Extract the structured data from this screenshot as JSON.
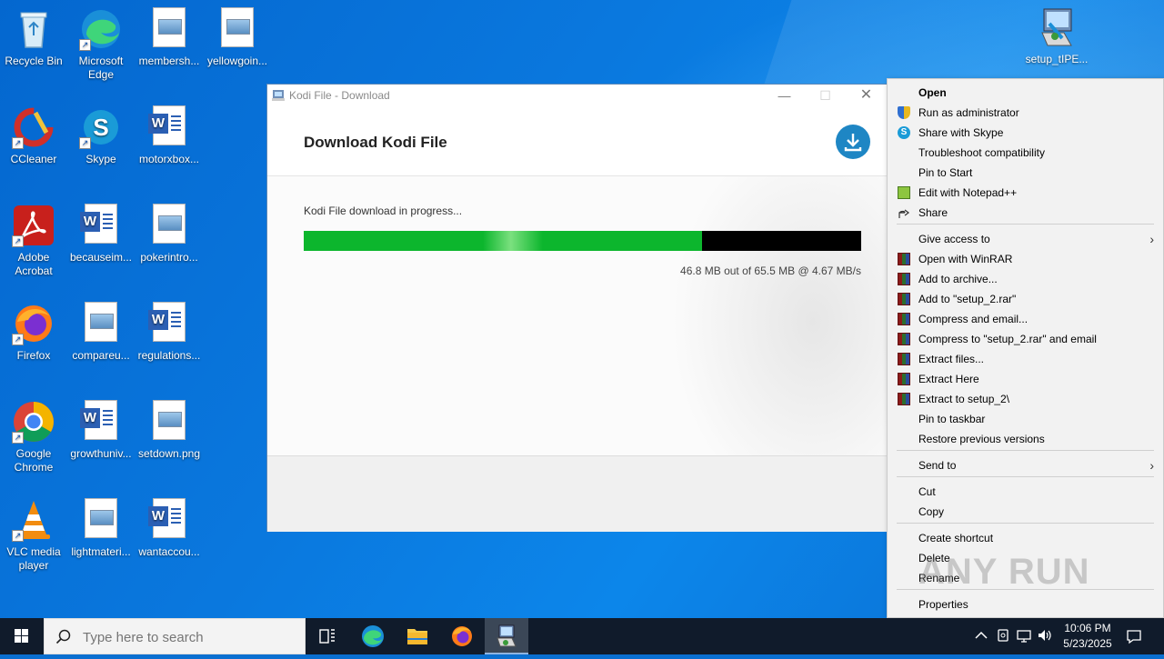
{
  "desktop": {
    "icons": [
      {
        "label": "Recycle Bin"
      },
      {
        "label": "Microsoft Edge"
      },
      {
        "label": "membersh..."
      },
      {
        "label": "yellowgoin..."
      },
      {
        "label": "CCleaner"
      },
      {
        "label": "Skype"
      },
      {
        "label": "motorxbox..."
      },
      {
        "label": "Adobe Acrobat"
      },
      {
        "label": "becauseim..."
      },
      {
        "label": "pokerintro..."
      },
      {
        "label": "Firefox"
      },
      {
        "label": "compareu..."
      },
      {
        "label": "regulations..."
      },
      {
        "label": "Google Chrome"
      },
      {
        "label": "growthuniv..."
      },
      {
        "label": "setdown.png"
      },
      {
        "label": "VLC media player"
      },
      {
        "label": "lightmateri..."
      },
      {
        "label": "wantaccou..."
      },
      {
        "label": "setup_tIPE..."
      }
    ]
  },
  "window": {
    "title": "Kodi File - Download",
    "header": "Download Kodi File",
    "progress_label": "Kodi File download in progress...",
    "progress_fraction": 0.714,
    "size_text": "46.8 MB out of 65.5 MB @ 4.67 MB/s"
  },
  "context_menu": {
    "items": [
      {
        "label": "Open",
        "bold": true
      },
      {
        "label": "Run as administrator",
        "icon": "shield-icon"
      },
      {
        "label": "Share with Skype",
        "icon": "skype-icon"
      },
      {
        "label": "Troubleshoot compatibility"
      },
      {
        "label": "Pin to Start"
      },
      {
        "label": "Edit with Notepad++",
        "icon": "notepadpp-icon"
      },
      {
        "label": "Share",
        "icon": "share-icon"
      },
      {
        "label": "Give access to",
        "submenu": true
      },
      {
        "label": "Open with WinRAR",
        "icon": "winrar-icon"
      },
      {
        "label": "Add to archive...",
        "icon": "winrar-icon"
      },
      {
        "label": "Add to \"setup_2.rar\"",
        "icon": "winrar-icon"
      },
      {
        "label": "Compress and email...",
        "icon": "winrar-icon"
      },
      {
        "label": "Compress to \"setup_2.rar\" and email",
        "icon": "winrar-icon"
      },
      {
        "label": "Extract files...",
        "icon": "winrar-icon"
      },
      {
        "label": "Extract Here",
        "icon": "winrar-icon"
      },
      {
        "label": "Extract to setup_2\\",
        "icon": "winrar-icon"
      },
      {
        "label": "Pin to taskbar"
      },
      {
        "label": "Restore previous versions"
      },
      {
        "label": "Send to",
        "submenu": true
      },
      {
        "label": "Cut"
      },
      {
        "label": "Copy"
      },
      {
        "label": "Create shortcut"
      },
      {
        "label": "Delete"
      },
      {
        "label": "Rename"
      },
      {
        "label": "Properties"
      }
    ]
  },
  "watermark": "ANY RUN",
  "taskbar": {
    "search_placeholder": "Type here to search",
    "time": "10:06 PM",
    "date": "5/23/2025"
  },
  "colors": {
    "progress_green": "#0cb62d",
    "accent_blue": "#1e86c4"
  }
}
